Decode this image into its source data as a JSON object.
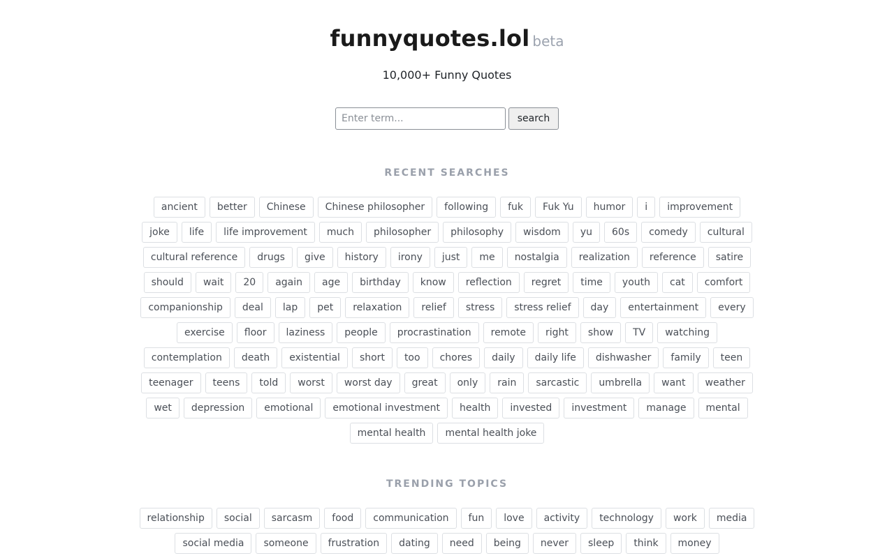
{
  "brand": {
    "name": "funnyquotes.lol",
    "badge": "beta"
  },
  "subtitle": "10,000+ Funny Quotes",
  "search": {
    "placeholder": "Enter term...",
    "value": "",
    "button_label": "search"
  },
  "recent_searches": {
    "heading": "RECENT SEARCHES",
    "tags": [
      "ancient",
      "better",
      "Chinese",
      "Chinese philosopher",
      "following",
      "fuk",
      "Fuk Yu",
      "humor",
      "i",
      "improvement",
      "joke",
      "life",
      "life improvement",
      "much",
      "philosopher",
      "philosophy",
      "wisdom",
      "yu",
      "60s",
      "comedy",
      "cultural",
      "cultural reference",
      "drugs",
      "give",
      "history",
      "irony",
      "just",
      "me",
      "nostalgia",
      "realization",
      "reference",
      "satire",
      "should",
      "wait",
      "20",
      "again",
      "age",
      "birthday",
      "know",
      "reflection",
      "regret",
      "time",
      "youth",
      "cat",
      "comfort",
      "companionship",
      "deal",
      "lap",
      "pet",
      "relaxation",
      "relief",
      "stress",
      "stress relief",
      "day",
      "entertainment",
      "every",
      "exercise",
      "floor",
      "laziness",
      "people",
      "procrastination",
      "remote",
      "right",
      "show",
      "TV",
      "watching",
      "contemplation",
      "death",
      "existential",
      "short",
      "too",
      "chores",
      "daily",
      "daily life",
      "dishwasher",
      "family",
      "teen",
      "teenager",
      "teens",
      "told",
      "worst",
      "worst day",
      "great",
      "only",
      "rain",
      "sarcastic",
      "umbrella",
      "want",
      "weather",
      "wet",
      "depression",
      "emotional",
      "emotional investment",
      "health",
      "invested",
      "investment",
      "manage",
      "mental",
      "mental health",
      "mental health joke"
    ]
  },
  "trending_topics": {
    "heading": "TRENDING TOPICS",
    "tags": [
      "relationship",
      "social",
      "sarcasm",
      "food",
      "communication",
      "fun",
      "love",
      "activity",
      "technology",
      "work",
      "media",
      "social media",
      "someone",
      "frustration",
      "dating",
      "need",
      "being",
      "never",
      "sleep",
      "think",
      "money"
    ]
  }
}
